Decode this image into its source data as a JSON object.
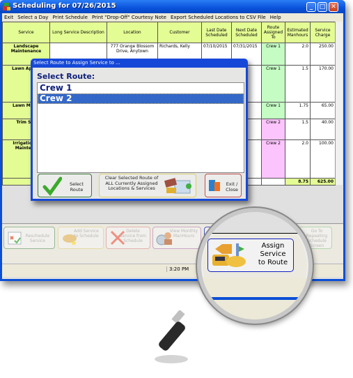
{
  "window": {
    "title": "Scheduling for 07/26/2015",
    "controls": [
      "minimize",
      "maximize",
      "close"
    ]
  },
  "menu": [
    "Exit",
    "Select a Day",
    "Print Schedule",
    "Print \"Drop-Off\" Courtesy Note",
    "Export Scheduled Locations to CSV File",
    "Help"
  ],
  "table": {
    "headers": [
      "Service",
      "Long Service Description",
      "Location",
      "Customer",
      "Last Date Scheduled",
      "Next Date Scheduled",
      "Route Assigned To",
      "Estimated Manhours",
      "Service Charge"
    ],
    "rows": [
      {
        "service": "Landscape Maintenance",
        "description": "",
        "location": "777 Orange Blossom Drive, Anytown",
        "customer": "Richards, Kelly",
        "last": "07/10/2015",
        "next": "07/31/2015",
        "route": "Crew 1",
        "hours": "2.0",
        "charge": "250.00"
      },
      {
        "service": "Lawn Applic",
        "description": "",
        "location": "",
        "customer": "",
        "last": "",
        "next": "",
        "route": "Crew 1",
        "hours": "1.5",
        "charge": "170.00"
      },
      {
        "service": "Lawn Maint",
        "description": "",
        "location": "",
        "customer": "",
        "last": "",
        "next": "015",
        "route": "Crew 1",
        "hours": "1.75",
        "charge": "65.00"
      },
      {
        "service": "Trim Shr",
        "description": "",
        "location": "",
        "customer": "",
        "last": "",
        "next": "015",
        "route": "Crew 2",
        "hours": "1.5",
        "charge": "40.00"
      },
      {
        "service": "Irrigation S Maintena",
        "description": "",
        "location": "",
        "customer": "",
        "last": "",
        "next": "015",
        "route": "Crew 2",
        "hours": "2.0",
        "charge": "100.00"
      }
    ],
    "totals": {
      "hours": "8.75",
      "charge": "625.00"
    }
  },
  "toolbar": [
    {
      "label": "Reschedule Service",
      "icon": "calendar-check-icon"
    },
    {
      "label": "Add Service to Schedule",
      "icon": "handshake-star-icon"
    },
    {
      "label": "Delete Service from Schedule",
      "icon": "red-x-icon"
    },
    {
      "label": "View Monthly ManHours",
      "icon": "clock-worker-icon"
    },
    {
      "label": "Assign Service to Route",
      "icon": "truck-handshake-icon"
    },
    {
      "label": "Go To Repeating Schedule Screen",
      "icon": "repeat-calendar-icon"
    }
  ],
  "status": {
    "time": "3:20 PM"
  },
  "dialog": {
    "title": "Select Route to Assign Service to ...",
    "label": "Select Route:",
    "routes": [
      "Crew 1",
      "Crew 2"
    ],
    "selected": "Crew 2",
    "buttons": {
      "select": "Select Route",
      "clear": "Clear Selected Route of ALL Currently Assigned Locations & Services",
      "exit": "Exit / Close"
    }
  },
  "magnifier": {
    "label": "Assign Service to Route"
  }
}
